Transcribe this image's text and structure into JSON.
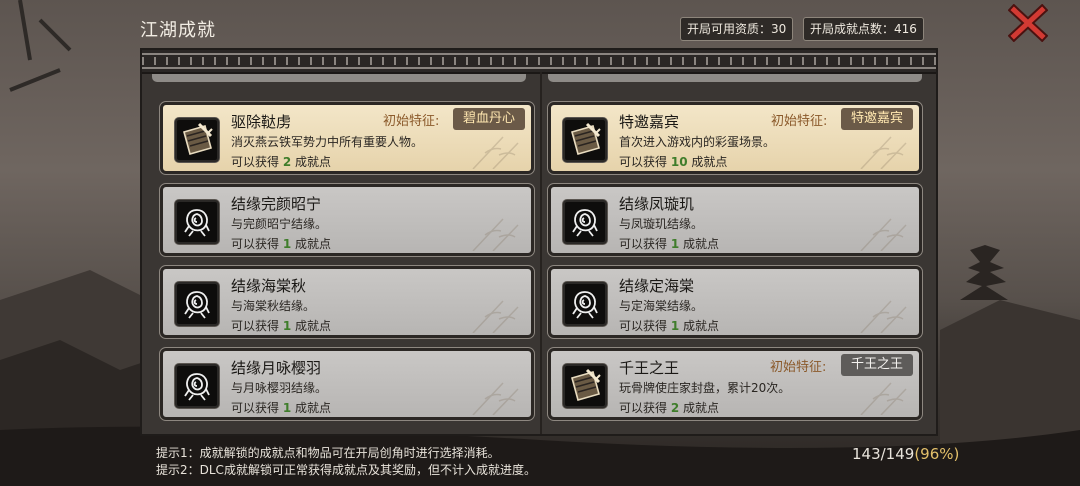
{
  "header": {
    "title": "江湖成就",
    "resource_label": "开局可用资质：30",
    "points_label": "开局成就点数：416"
  },
  "achievements": [
    {
      "name": "驱除鞑虏",
      "desc": "消灭燕云铁军势力中所有重要人物。",
      "reward_prefix": "可以获得",
      "reward_value": "2",
      "reward_suffix": "成就点",
      "trait_label": "初始特征:",
      "trait_value": "碧血丹心",
      "icon": "scroll-sword-icon",
      "style": "gold"
    },
    {
      "name": "特邀嘉宾",
      "desc": "首次进入游戏内的彩蛋场景。",
      "reward_prefix": "可以获得",
      "reward_value": "10",
      "reward_suffix": "成就点",
      "trait_label": "初始特征:",
      "trait_value": "特邀嘉宾",
      "icon": "scroll-sword-icon",
      "style": "gold"
    },
    {
      "name": "结缘完颜昭宁",
      "desc": "与完颜昭宁结缘。",
      "reward_prefix": "可以获得",
      "reward_value": "1",
      "reward_suffix": "成就点",
      "icon": "rose-icon",
      "style": "grey"
    },
    {
      "name": "结缘凤璇玑",
      "desc": "与凤璇玑结缘。",
      "reward_prefix": "可以获得",
      "reward_value": "1",
      "reward_suffix": "成就点",
      "icon": "rose-icon",
      "style": "grey"
    },
    {
      "name": "结缘海棠秋",
      "desc": "与海棠秋结缘。",
      "reward_prefix": "可以获得",
      "reward_value": "1",
      "reward_suffix": "成就点",
      "icon": "rose-icon",
      "style": "grey"
    },
    {
      "name": "结缘定海棠",
      "desc": "与定海棠结缘。",
      "reward_prefix": "可以获得",
      "reward_value": "1",
      "reward_suffix": "成就点",
      "icon": "rose-icon",
      "style": "grey"
    },
    {
      "name": "结缘月咏樱羽",
      "desc": "与月咏樱羽结缘。",
      "reward_prefix": "可以获得",
      "reward_value": "1",
      "reward_suffix": "成就点",
      "icon": "rose-icon",
      "style": "grey"
    },
    {
      "name": "千王之王",
      "desc": "玩骨牌使庄家封盘，累计20次。",
      "reward_prefix": "可以获得",
      "reward_value": "2",
      "reward_suffix": "成就点",
      "trait_label": "初始特征:",
      "trait_value": "千王之王",
      "icon": "scroll-sword-icon",
      "style": "grey"
    }
  ],
  "hints": [
    "提示1：成就解锁的成就点和物品可在开局创角时进行选择消耗。",
    "提示2：DLC成就解锁可正常获得成就点及其奖励，但不计入成就进度。"
  ],
  "progress": {
    "count": "143/149",
    "percent": "(96%)"
  },
  "colors": {
    "gold_card": "#f3e6c8",
    "grey_card": "#c9c7c5",
    "reward_green": "#3f7d2b",
    "close_red": "#c8322d"
  }
}
